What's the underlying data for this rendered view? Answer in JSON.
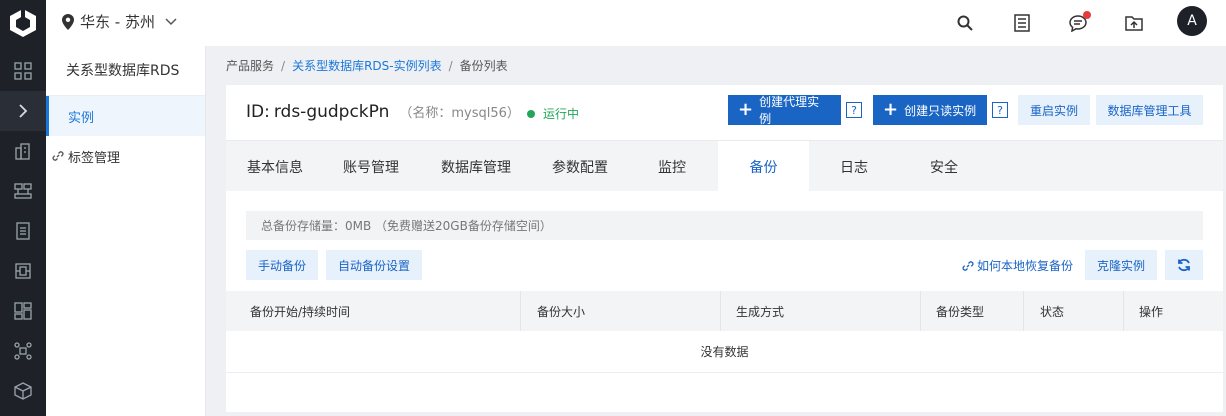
{
  "topbar": {
    "region": "华东 - 苏州",
    "avatar_letter": "A"
  },
  "sidebar": {
    "title": "关系型数据库RDS",
    "items": [
      {
        "label": "实例",
        "active": true
      },
      {
        "label": "标签管理",
        "active": false
      }
    ]
  },
  "breadcrumb": {
    "root": "产品服务",
    "parent": "关系型数据库RDS-实例列表",
    "current": "备份列表",
    "separator": "/"
  },
  "instance": {
    "id_label": "ID:",
    "id": "rds-gudpckPn",
    "alias": "（名称：mysql56）",
    "status": "运行中",
    "status_color": "#23a55a"
  },
  "actions": {
    "create_proxy": "创建代理实例",
    "create_readonly": "创建只读实例",
    "help": "?",
    "restart": "重启实例",
    "db_tool": "数据库管理工具"
  },
  "tabs": [
    {
      "label": "基本信息"
    },
    {
      "label": "账号管理"
    },
    {
      "label": "数据库管理"
    },
    {
      "label": "参数配置"
    },
    {
      "label": "监控"
    },
    {
      "label": "备份",
      "active": true
    },
    {
      "label": "日志"
    },
    {
      "label": "安全"
    }
  ],
  "backup": {
    "storage_text": "总备份存储量：0MB （免费赠送20GB备份存储空间）",
    "manual_backup": "手动备份",
    "auto_backup_settings": "自动备份设置",
    "restore_help_link": "如何本地恢复备份",
    "clone_instance": "克隆实例"
  },
  "table": {
    "columns": [
      "备份开始/持续时间",
      "备份大小",
      "生成方式",
      "备份类型",
      "状态",
      "操作"
    ],
    "empty_text": "没有数据"
  },
  "colors": {
    "primary": "#1a64c4",
    "link": "#1a78d9",
    "nav_bg": "#1e2228"
  }
}
